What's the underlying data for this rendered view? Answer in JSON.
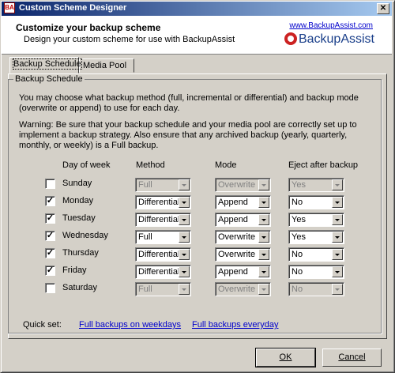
{
  "window": {
    "title": "Custom Scheme Designer",
    "app_icon_text": "BA",
    "close_glyph": "✕"
  },
  "header": {
    "title": "Customize your backup scheme",
    "subtitle": "Design your custom scheme for use with BackupAssist",
    "url": "www.BackupAssist.com",
    "logo_text": "BackupAssist"
  },
  "tabs": [
    {
      "label": "Backup Schedule",
      "active": true
    },
    {
      "label": "Media Pool",
      "active": false
    }
  ],
  "group_label": "Backup Schedule",
  "intro_text": "You may choose what backup method (full, incremental or differential) and backup mode (overwrite or append) to use for each day.",
  "warning_text": "Warning: Be sure that your backup schedule and your media pool are correctly set up to implement a backup strategy. Also ensure that any archived backup (yearly, quarterly, monthly, or weekly) is a Full backup.",
  "columns": {
    "day": "Day of week",
    "method": "Method",
    "mode": "Mode",
    "eject": "Eject after backup"
  },
  "days": [
    {
      "name": "Sunday",
      "checked": false,
      "method": "Full",
      "mode": "Overwrite",
      "eject": "Yes"
    },
    {
      "name": "Monday",
      "checked": true,
      "method": "Differential",
      "mode": "Append",
      "eject": "No"
    },
    {
      "name": "Tuesday",
      "checked": true,
      "method": "Differential",
      "mode": "Append",
      "eject": "Yes"
    },
    {
      "name": "Wednesday",
      "checked": true,
      "method": "Full",
      "mode": "Overwrite",
      "eject": "Yes"
    },
    {
      "name": "Thursday",
      "checked": true,
      "method": "Differential",
      "mode": "Overwrite",
      "eject": "No"
    },
    {
      "name": "Friday",
      "checked": true,
      "method": "Differential",
      "mode": "Append",
      "eject": "No"
    },
    {
      "name": "Saturday",
      "checked": false,
      "method": "Full",
      "mode": "Overwrite",
      "eject": "No"
    }
  ],
  "quickset": {
    "label": "Quick set:",
    "weekdays": "Full backups on weekdays",
    "everyday": "Full backups everyday"
  },
  "buttons": {
    "ok": "OK",
    "cancel": "Cancel"
  }
}
